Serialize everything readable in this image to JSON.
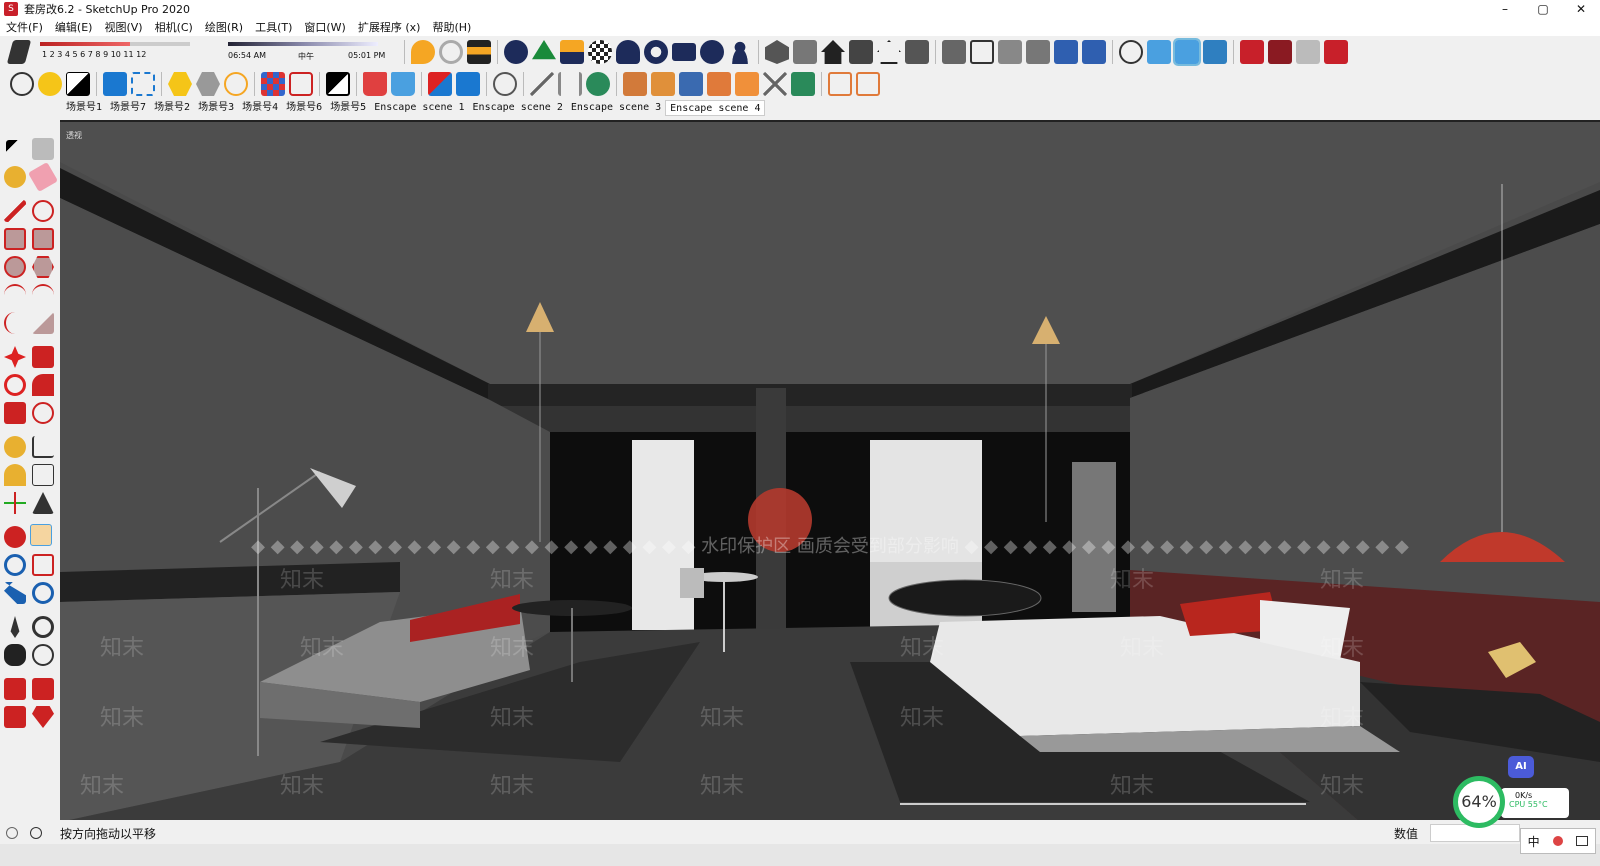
{
  "window": {
    "title": "套房改6.2 - SketchUp Pro 2020",
    "controls": [
      "–",
      "▢",
      "✕"
    ]
  },
  "menu": [
    "文件(F)",
    "编辑(E)",
    "视图(V)",
    "相机(C)",
    "绘图(R)",
    "工具(T)",
    "窗口(W)",
    "扩展程序 (x)",
    "帮助(H)"
  ],
  "shadow": {
    "months": "1 2 3 4 5 6 7 8 9 10 11 12",
    "time_start": "06:54 AM",
    "time_mid": "中午",
    "time_end": "05:01 PM"
  },
  "scenes": [
    {
      "label": "场景号1",
      "active": false
    },
    {
      "label": "场景号7",
      "active": false
    },
    {
      "label": "场景号2",
      "active": false
    },
    {
      "label": "场景号3",
      "active": false
    },
    {
      "label": "场景号4",
      "active": false
    },
    {
      "label": "场景号6",
      "active": false
    },
    {
      "label": "场景号5",
      "active": false
    },
    {
      "label": "Enscape scene 1",
      "active": false
    },
    {
      "label": "Enscape scene 2",
      "active": false
    },
    {
      "label": "Enscape scene 3",
      "active": false
    },
    {
      "label": "Enscape scene 4",
      "active": true
    }
  ],
  "viewport": {
    "label": "透视",
    "watermark_main": "◆ ◆ ◆ ◆ ◆ ◆ ◆ ◆ ◆ ◆ ◆ ◆ ◆ ◆ ◆ ◆ ◆ ◆ ◆ ◆ ◆ ◆ ◆ 水印保护区 画质会受到部分影响 ◆ ◆ ◆ ◆ ◆ ◆ ◆ ◆ ◆ ◆ ◆ ◆ ◆ ◆ ◆ ◆ ◆ ◆ ◆ ◆ ◆ ◆ ◆",
    "watermark_tile": "知末"
  },
  "status": {
    "hint": "按方向拖动以平移",
    "measurements_label": "数值"
  },
  "monitor": {
    "cpu_percent": "64%",
    "net": "0K/s",
    "cpu_temp": "CPU 55°C",
    "ai_label": "AI"
  },
  "ime": {
    "lang": "中"
  }
}
